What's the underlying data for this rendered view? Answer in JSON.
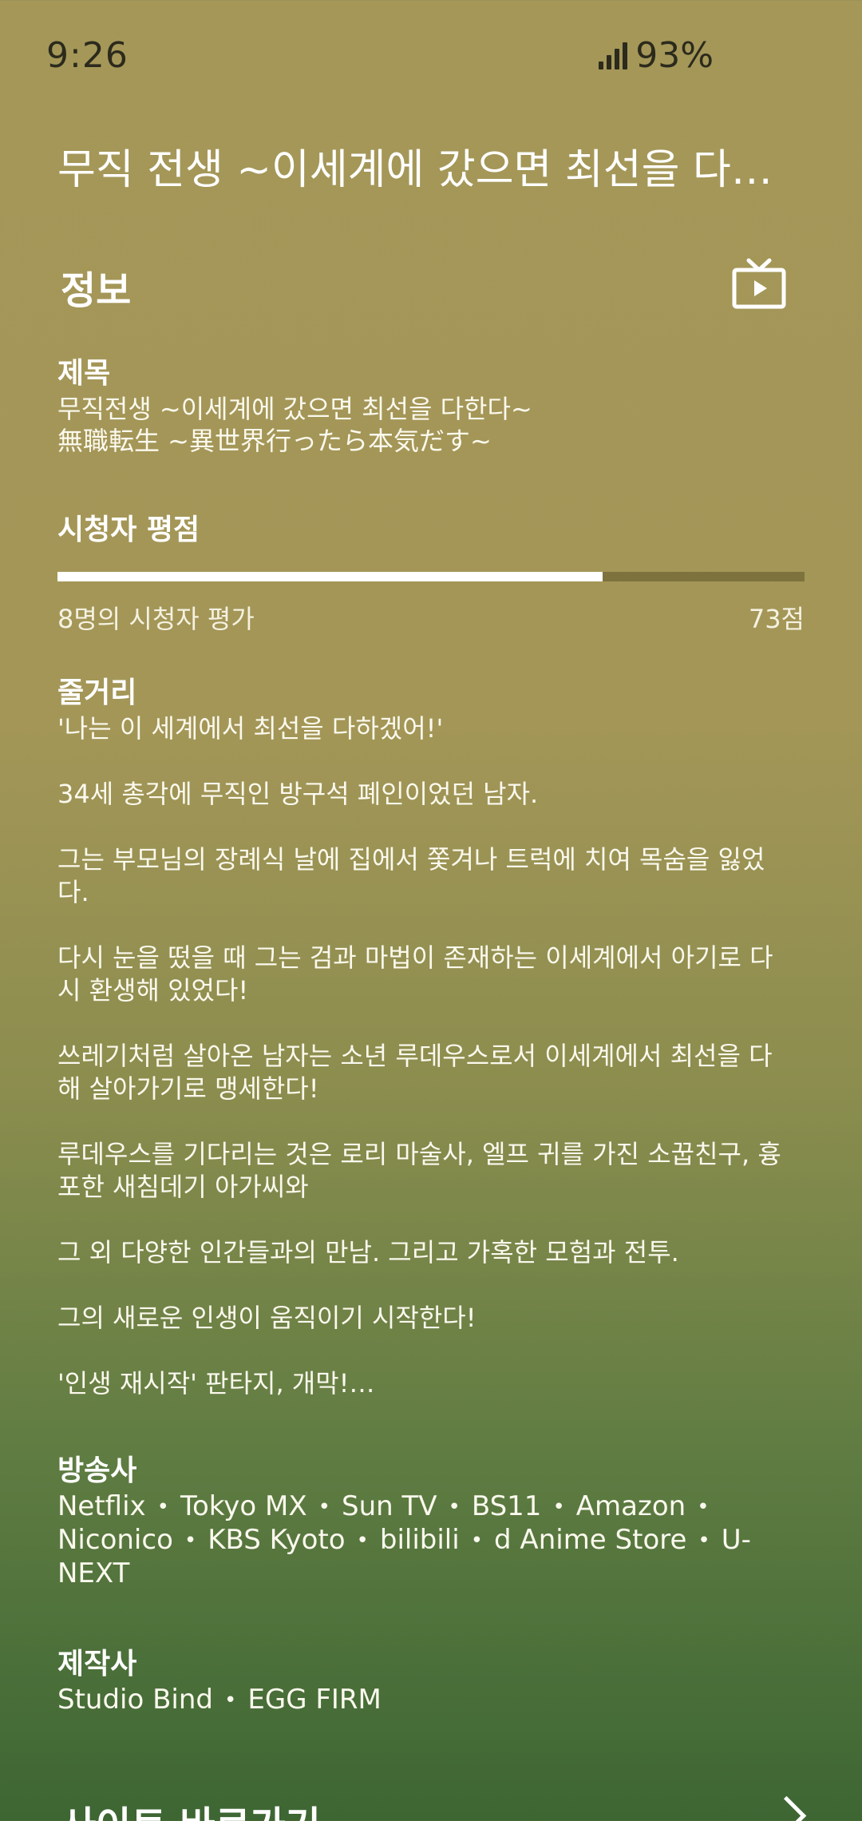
{
  "status_bar": {
    "time": "9:26",
    "battery": "93%",
    "icons": [
      "signal-icon"
    ]
  },
  "header": {
    "title": "무직 전생 ~이세계에 갔으면 최선을 다한…"
  },
  "info": {
    "section_title": "정보",
    "tv_icon": "tv-play-icon",
    "title_label": "제목",
    "title_ko": "무직전생 ~이세계에 갔으면 최선을 다한다~",
    "title_ja": "無職転生 ~異世界行ったら本気だす~",
    "rating": {
      "label": "시청자 평점",
      "count_text": "8명의 시청자 평가",
      "score_text": "73점",
      "score": 73,
      "max": 100
    },
    "synopsis": {
      "label": "줄거리",
      "paragraphs": [
        "'나는 이 세계에서 최선을 다하겠어!'",
        "34세 총각에 무직인 방구석 폐인이었던 남자.",
        "그는 부모님의 장례식 날에 집에서 쫓겨나 트럭에 치여 목숨을 잃었다.",
        "다시 눈을 떴을 때 그는 검과 마법이 존재하는 이세계에서 아기로 다시 환생해 있었다!",
        "쓰레기처럼 살아온 남자는 소년 루데우스로서 이세계에서 최선을 다해 살아가기로 맹세한다!",
        "루데우스를 기다리는 것은 로리 마술사, 엘프 귀를 가진 소꿉친구, 흉포한 새침데기 아가씨와",
        "그 외 다양한 인간들과의 만남. 그리고 가혹한 모험과 전투.",
        "그의 새로운 인생이 움직이기 시작한다!",
        "'인생 재시작' 판타지, 개막!…"
      ]
    },
    "broadcasters": {
      "label": "방송사",
      "items": [
        "Netflix",
        "Tokyo MX",
        "Sun TV",
        "BS11",
        "Amazon",
        "Niconico",
        "KBS Kyoto",
        "bilibili",
        "d Anime Store",
        "U-NEXT"
      ]
    },
    "producers": {
      "label": "제작사",
      "items": [
        "Studio Bind",
        "EGG FIRM"
      ]
    }
  },
  "footer": {
    "link_label": "사이트 바로가기",
    "chevron_icon": "chevron-right-icon"
  },
  "colors": {
    "background_top": "#a59758",
    "background_bottom": "#3d6633",
    "text": "#ffffff",
    "status_text": "#2b2a1c"
  }
}
